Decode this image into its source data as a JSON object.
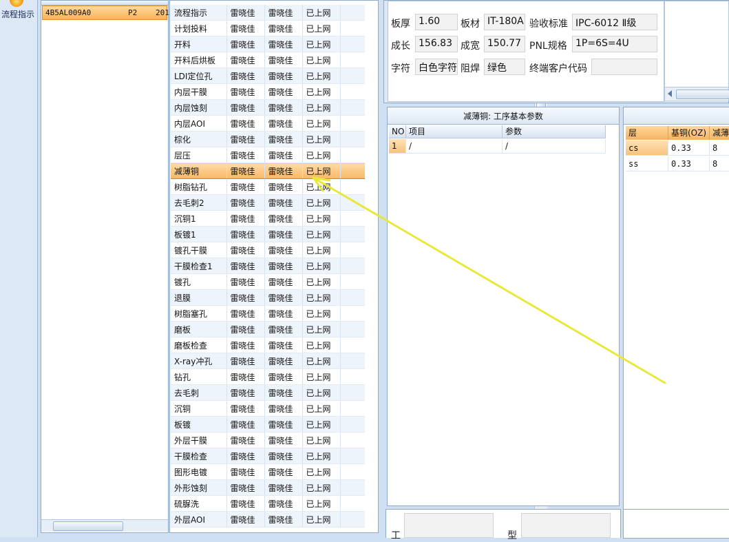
{
  "toolbar": {
    "flow_label": "流程指示"
  },
  "order_list": {
    "row": {
      "code": "4B5AL009A0",
      "rev": "P2",
      "extra": "201"
    }
  },
  "process_list": {
    "rows": [
      {
        "step": "流程指示",
        "col2": "雷晓佳",
        "col3": "雷晓佳",
        "status": "已上网"
      },
      {
        "step": "计划投料",
        "col2": "雷晓佳",
        "col3": "雷晓佳",
        "status": "已上网"
      },
      {
        "step": "开料",
        "col2": "雷晓佳",
        "col3": "雷晓佳",
        "status": "已上网"
      },
      {
        "step": "开料后烘板",
        "col2": "雷晓佳",
        "col3": "雷晓佳",
        "status": "已上网"
      },
      {
        "step": "LDI定位孔",
        "col2": "雷晓佳",
        "col3": "雷晓佳",
        "status": "已上网"
      },
      {
        "step": "内层干膜",
        "col2": "雷晓佳",
        "col3": "雷晓佳",
        "status": "已上网"
      },
      {
        "step": "内层蚀刻",
        "col2": "雷晓佳",
        "col3": "雷晓佳",
        "status": "已上网"
      },
      {
        "step": "内层AOI",
        "col2": "雷晓佳",
        "col3": "雷晓佳",
        "status": "已上网"
      },
      {
        "step": "棕化",
        "col2": "雷晓佳",
        "col3": "雷晓佳",
        "status": "已上网"
      },
      {
        "step": "层压",
        "col2": "雷晓佳",
        "col3": "雷晓佳",
        "status": "已上网"
      },
      {
        "step": "减薄铜",
        "col2": "雷晓佳",
        "col3": "雷晓佳",
        "status": "已上网"
      },
      {
        "step": "树脂钻孔",
        "col2": "雷晓佳",
        "col3": "雷晓佳",
        "status": "已上网"
      },
      {
        "step": "去毛刺2",
        "col2": "雷晓佳",
        "col3": "雷晓佳",
        "status": "已上网"
      },
      {
        "step": "沉铜1",
        "col2": "雷晓佳",
        "col3": "雷晓佳",
        "status": "已上网"
      },
      {
        "step": "板镀1",
        "col2": "雷晓佳",
        "col3": "雷晓佳",
        "status": "已上网"
      },
      {
        "step": "镀孔干膜",
        "col2": "雷晓佳",
        "col3": "雷晓佳",
        "status": "已上网"
      },
      {
        "step": "干膜检查1",
        "col2": "雷晓佳",
        "col3": "雷晓佳",
        "status": "已上网"
      },
      {
        "step": "镀孔",
        "col2": "雷晓佳",
        "col3": "雷晓佳",
        "status": "已上网"
      },
      {
        "step": "退膜",
        "col2": "雷晓佳",
        "col3": "雷晓佳",
        "status": "已上网"
      },
      {
        "step": "树脂塞孔",
        "col2": "雷晓佳",
        "col3": "雷晓佳",
        "status": "已上网"
      },
      {
        "step": "磨板",
        "col2": "雷晓佳",
        "col3": "雷晓佳",
        "status": "已上网"
      },
      {
        "step": "磨板检查",
        "col2": "雷晓佳",
        "col3": "雷晓佳",
        "status": "已上网"
      },
      {
        "step": "X-ray冲孔",
        "col2": "雷晓佳",
        "col3": "雷晓佳",
        "status": "已上网"
      },
      {
        "step": "钻孔",
        "col2": "雷晓佳",
        "col3": "雷晓佳",
        "status": "已上网"
      },
      {
        "step": "去毛刺",
        "col2": "雷晓佳",
        "col3": "雷晓佳",
        "status": "已上网"
      },
      {
        "step": "沉铜",
        "col2": "雷晓佳",
        "col3": "雷晓佳",
        "status": "已上网"
      },
      {
        "step": "板镀",
        "col2": "雷晓佳",
        "col3": "雷晓佳",
        "status": "已上网"
      },
      {
        "step": "外层干膜",
        "col2": "雷晓佳",
        "col3": "雷晓佳",
        "status": "已上网"
      },
      {
        "step": "干膜检查",
        "col2": "雷晓佳",
        "col3": "雷晓佳",
        "status": "已上网"
      },
      {
        "step": "图形电镀",
        "col2": "雷晓佳",
        "col3": "雷晓佳",
        "status": "已上网"
      },
      {
        "step": "外形蚀刻",
        "col2": "雷晓佳",
        "col3": "雷晓佳",
        "status": "已上网"
      },
      {
        "step": "硫脲洗",
        "col2": "雷晓佳",
        "col3": "雷晓佳",
        "status": "已上网"
      },
      {
        "step": "外层AOI",
        "col2": "雷晓佳",
        "col3": "雷晓佳",
        "status": "已上网"
      }
    ]
  },
  "info": {
    "board_thickness_label": "板厚",
    "board_thickness_value": "1.60",
    "material_label": "板材",
    "material_value": "IT-180A",
    "acceptance_label": "验收标准",
    "acceptance_value": "IPC-6012 Ⅱ级",
    "length_label": "成长",
    "length_value": "156.83",
    "width_label": "成宽",
    "width_value": "150.77",
    "pnl_label": "PNL规格",
    "pnl_value": "1P=6S=4U",
    "legend_label": "字符",
    "legend_value": "白色字符",
    "mask_label": "阻焊",
    "mask_value": "绿色",
    "customer_code_label": "终端客户代码",
    "customer_code_value": ""
  },
  "params": {
    "title": "减薄铜: 工序基本参数",
    "headers": {
      "no": "NO",
      "item": "项目",
      "param": "参数"
    },
    "rows": [
      {
        "no": "1",
        "item": "/",
        "param": "/"
      }
    ]
  },
  "layers": {
    "headers": {
      "layer": "层",
      "base_copper": "基铜(OZ)",
      "thin": "减薄"
    },
    "rows": [
      {
        "layer": "cs",
        "base_copper": "0.33",
        "thin": "8"
      },
      {
        "layer": "ss",
        "base_copper": "0.33",
        "thin": "8"
      }
    ]
  },
  "bottom": {
    "left_label": "工",
    "right_label": "型"
  },
  "colors": {
    "annotation_arrow": "#e8e83a",
    "selection": "#f8b865"
  }
}
